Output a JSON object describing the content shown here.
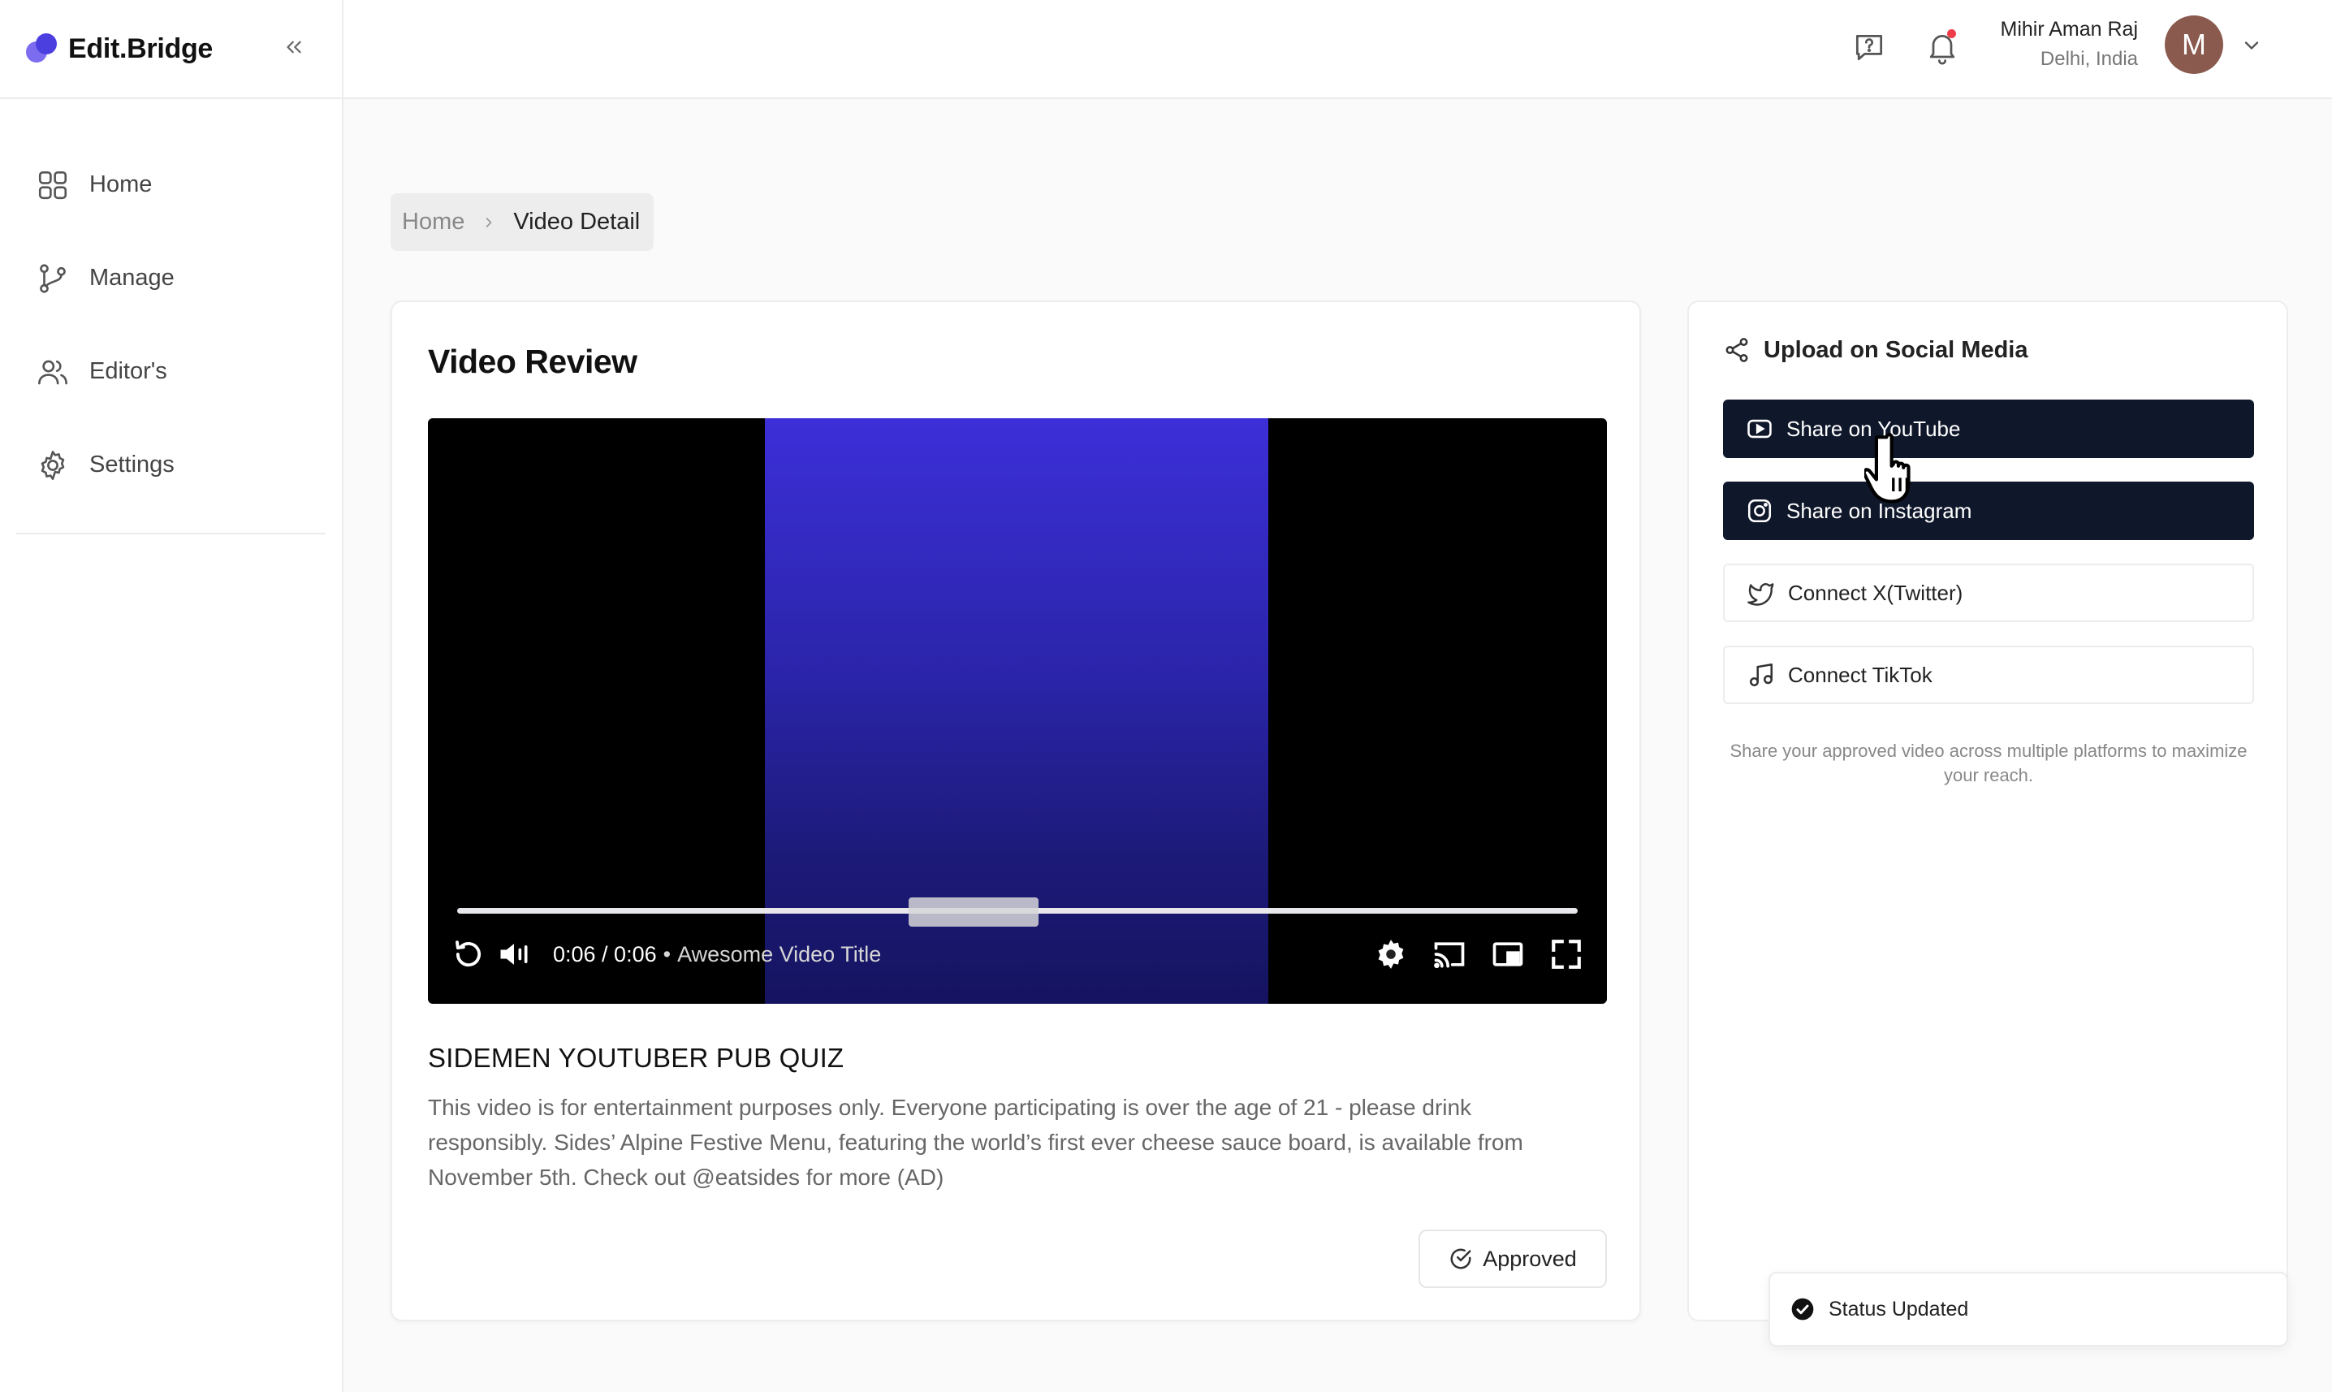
{
  "brand": {
    "name": "Edit.Bridge"
  },
  "sidebar": {
    "items": [
      {
        "label": "Home",
        "icon": "grid-icon"
      },
      {
        "label": "Manage",
        "icon": "git-branch-icon"
      },
      {
        "label": "Editor's",
        "icon": "users-icon"
      },
      {
        "label": "Settings",
        "icon": "gear-icon"
      }
    ]
  },
  "topbar": {
    "user_name": "Mihir Aman Raj",
    "user_location": "Delhi, India",
    "avatar_initial": "M"
  },
  "breadcrumb": {
    "home": "Home",
    "current": "Video Detail"
  },
  "review": {
    "title": "Video Review",
    "player": {
      "time": "0:06 / 0:06",
      "separator": "•",
      "video_title": "Awesome Video Title",
      "progress": 1.0
    },
    "video_heading": "SIDEMEN YOUTUBER PUB QUIZ",
    "video_description": "This video is for entertainment purposes only. Everyone participating is over the age of 21 - please drink responsibly. Sides’ Alpine Festive Menu, featuring the world’s first ever cheese sauce board, is available from November 5th. Check out @eatsides for more (AD)",
    "approved_label": "Approved"
  },
  "social": {
    "title": "Upload on Social Media",
    "buttons": [
      {
        "label": "Share on YouTube",
        "style": "dark"
      },
      {
        "label": "Share on Instagram",
        "style": "dark"
      },
      {
        "label": "Connect X(Twitter)",
        "style": "light"
      },
      {
        "label": "Connect TikTok",
        "style": "light"
      }
    ],
    "note": "Share your approved video across multiple platforms to maximize your reach."
  },
  "toast": {
    "message": "Status Updated"
  },
  "colors": {
    "accent": "#4c3fe0",
    "dark_button": "#0f172a",
    "notification_dot": "#ef3e4a",
    "video_bg": "#2a24a8"
  }
}
